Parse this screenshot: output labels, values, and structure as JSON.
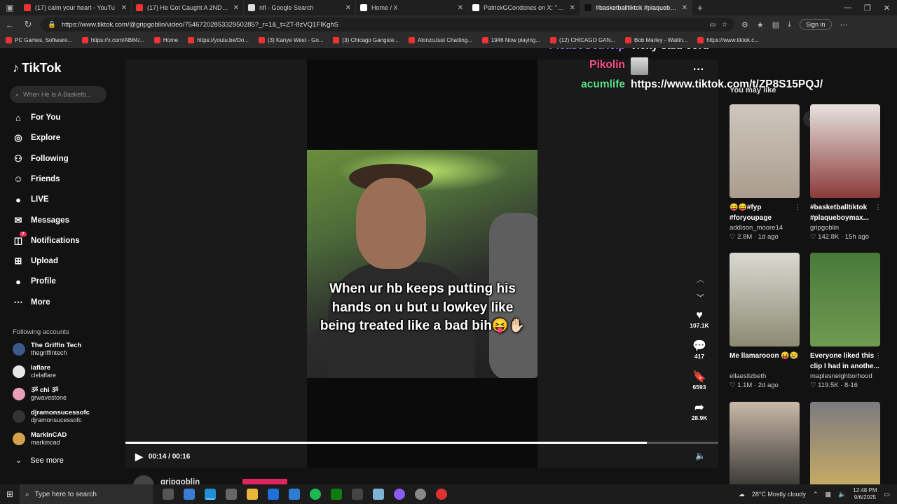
{
  "browser": {
    "tabs": [
      {
        "title": "(17) calm your heart - YouTu",
        "fav": "#e33",
        "active": false
      },
      {
        "title": "(17) He Got Caught A 2ND TIME",
        "fav": "#e33",
        "active": false
      },
      {
        "title": "nfl - Google Search",
        "fav": "#ddd",
        "active": false
      },
      {
        "title": "Home / X",
        "fav": "#fff",
        "active": false
      },
      {
        "title": "PatrickGCondones on X: \"https://",
        "fav": "#fff",
        "active": false
      },
      {
        "title": "#basketballtiktok #plaqueboym",
        "fav": "#111",
        "active": true
      }
    ],
    "url": "https://www.tiktok.com/@gripgoblin/video/7546720285332950285?_r=1&_t=ZT-8zVQ1FIKghS",
    "signin": "Sign in",
    "bookmarks": [
      "PC Games, Software...",
      "https://x.com/AB84/...",
      "Home",
      "https://youtu.be/Do...",
      "(3) Kanye West - Go...",
      "(3) Chicago Gangste...",
      "AlonzoJust Chatting...",
      "1946 Now playing...",
      "(12) CHICAGO GAN...",
      "Bob Marley - Waitin...",
      "https://www.tiktok.c..."
    ]
  },
  "sidebar": {
    "logo": "TikTok",
    "search_placeholder": "When He Is A Basketb...",
    "nav": [
      {
        "label": "For You",
        "icon": "home-icon"
      },
      {
        "label": "Explore",
        "icon": "compass-icon"
      },
      {
        "label": "Following",
        "icon": "following-icon"
      },
      {
        "label": "Friends",
        "icon": "friends-icon"
      },
      {
        "label": "LIVE",
        "icon": "live-icon"
      },
      {
        "label": "Messages",
        "icon": "messages-icon"
      },
      {
        "label": "Notifications",
        "icon": "notifications-icon",
        "badge": "7"
      },
      {
        "label": "Upload",
        "icon": "upload-icon"
      },
      {
        "label": "Profile",
        "icon": "profile-icon"
      },
      {
        "label": "More",
        "icon": "more-icon"
      }
    ],
    "following_title": "Following accounts",
    "accounts": [
      {
        "name": "The Griffin Tech",
        "handle": "thegriffintech"
      },
      {
        "name": "laflare",
        "handle": "clelaflare"
      },
      {
        "name": "ૐ chi ૐ",
        "handle": "grwavestone"
      },
      {
        "name": "djramonsucessofc",
        "handle": "djramonsucessofc"
      },
      {
        "name": "MarkInCAD",
        "handle": "markincad"
      }
    ],
    "see_more": "See more"
  },
  "video": {
    "caption": "When ur hb keeps putting his hands on u but u lowkey like being treated like a bad bih😝✋🏻",
    "time": "00:14 / 00:16",
    "progress": 0.88,
    "likes": "107.1K",
    "comments": "417",
    "saves": "6593",
    "shares": "28.9K",
    "author": "gripgoblin"
  },
  "overlay": {
    "lines": [
      {
        "name": "PleaseGetHelp",
        "text": "vicky said cord",
        "color": "#b388ff"
      },
      {
        "name": "Pikolin",
        "text": "",
        "color": "#ff4d8d"
      },
      {
        "name": "acumlife",
        "text": "https://www.tiktok.com/t/ZP8S15PQJ/",
        "color": "#5ee08a"
      }
    ]
  },
  "you_may_like": {
    "title": "You may like",
    "cards": [
      {
        "title": "😝😝#fyp #foryoupage",
        "user": "addison_moore14",
        "likes": "2.8M",
        "age": "1d ago"
      },
      {
        "title": "#basketballtiktok #plaqueboymax...",
        "user": "gripgoblin",
        "likes": "142.8K",
        "age": "15h ago"
      },
      {
        "title": "Me llamarooon 😝😢",
        "user": "ellaeslizbeth",
        "likes": "1.1M",
        "age": "2d ago"
      },
      {
        "title": "Everyone liked this clip I had in anothe...",
        "user": "maplesneighborhood",
        "likes": "119.5K",
        "age": "8-16"
      },
      {
        "title": "",
        "user": "",
        "likes": "",
        "age": ""
      },
      {
        "title": "",
        "user": "",
        "likes": "",
        "age": ""
      }
    ]
  },
  "taskbar": {
    "search_placeholder": "Type here to search",
    "weather": "28°C  Mostly cloudy",
    "time": "12:48 PM",
    "date": "9/6/2025"
  }
}
